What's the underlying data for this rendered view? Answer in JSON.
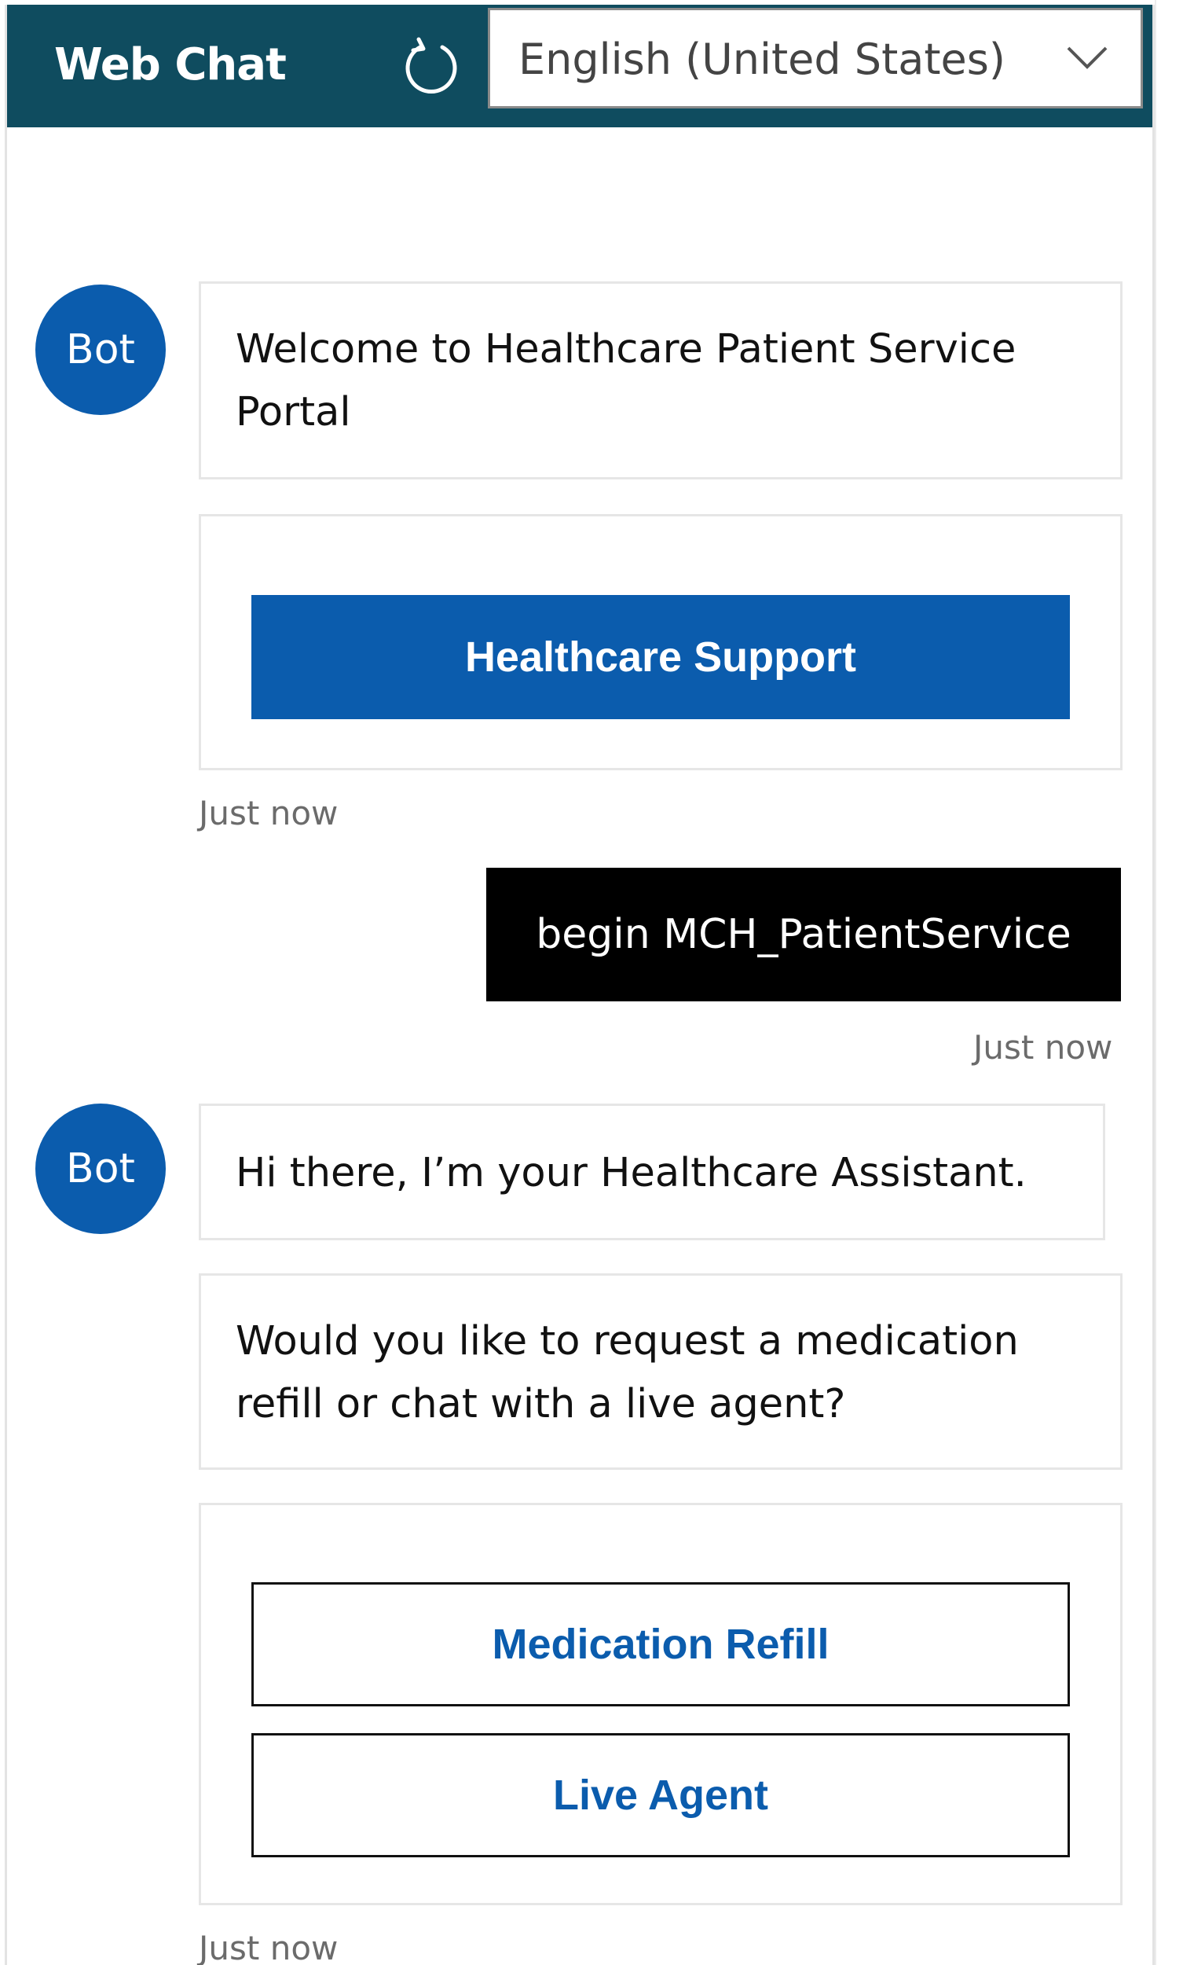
{
  "header": {
    "title": "Web Chat",
    "refresh_icon": "refresh-icon",
    "language": {
      "selected": "English (United States)",
      "icon": "chevron-down-icon"
    }
  },
  "colors": {
    "header_bg": "#0f4c5f",
    "accent": "#0b5cad",
    "user_bubble_bg": "#000000",
    "timestamp": "#6b6b6b"
  },
  "messages": [
    {
      "from": "bot",
      "avatar": "Bot",
      "text": "Welcome to Healthcare Patient Service Portal",
      "card_button": "Healthcare Support",
      "timestamp": "Just now"
    },
    {
      "from": "user",
      "text": "begin MCH_PatientService",
      "timestamp": "Just now"
    },
    {
      "from": "bot",
      "avatar": "Bot",
      "greeting": "Hi there, I’m your Healthcare Assistant.",
      "question": "Would you like to request a medication refill or chat with a live agent?",
      "actions": [
        "Medication Refill",
        "Live Agent"
      ],
      "timestamp": "Just now"
    }
  ]
}
